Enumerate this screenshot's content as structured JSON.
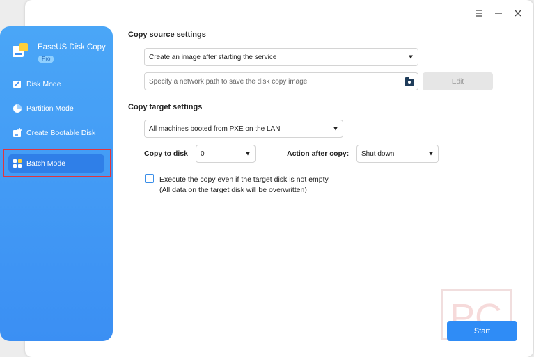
{
  "titlebar": {
    "menu_icon": "hamburger-icon",
    "minimize_icon": "minimize-icon",
    "close_icon": "close-icon"
  },
  "sidebar": {
    "app_name": "EaseUS Disk Copy",
    "edition_badge": "Pro",
    "items": [
      {
        "label": "Disk Mode",
        "icon": "disk-icon",
        "active": false
      },
      {
        "label": "Partition Mode",
        "icon": "pie-chart-icon",
        "active": false
      },
      {
        "label": "Create Bootable Disk",
        "icon": "bootable-disk-icon",
        "active": false
      },
      {
        "label": "Batch Mode",
        "icon": "grid-icon",
        "active": true
      }
    ]
  },
  "source": {
    "section_title": "Copy source settings",
    "mode_select": "Create an image after starting the service",
    "path_placeholder": "Specify a network path to save the disk copy image",
    "edit_label": "Edit"
  },
  "target": {
    "section_title": "Copy target settings",
    "machines_select": "All machines booted from PXE on the LAN",
    "copy_to_disk_label": "Copy to disk",
    "copy_to_disk_value": "0",
    "action_label": "Action after copy:",
    "action_value": "Shut down",
    "force_copy_line1": "Execute the copy even if the target disk is not empty.",
    "force_copy_line2": "(All data on the target disk will be overwritten)",
    "force_copy_checked": false
  },
  "start_label": "Start",
  "colors": {
    "accent": "#2f8cf6",
    "sidebar_top": "#4aa6f7",
    "highlight": "#e0353f"
  }
}
